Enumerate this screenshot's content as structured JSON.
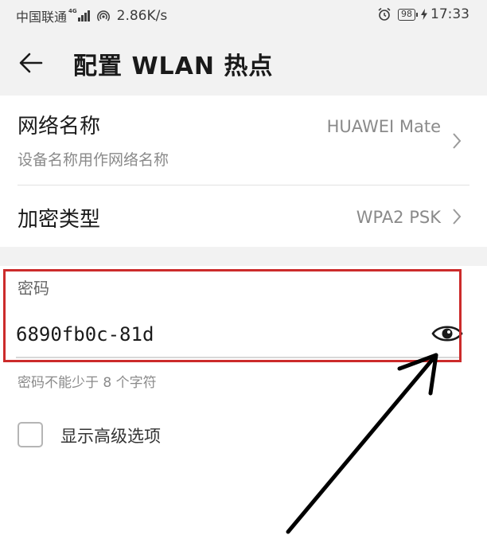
{
  "status_bar": {
    "carrier": "中国联通",
    "network": "4G",
    "speed": "2.86K/s",
    "battery": "98",
    "time": "17:33"
  },
  "header": {
    "title": "配置 WLAN 热点",
    "back_icon": "arrow-left-icon"
  },
  "network_name": {
    "title": "网络名称",
    "subtitle": "设备名称用作网络名称",
    "value": "HUAWEI Mate"
  },
  "encryption": {
    "title": "加密类型",
    "value": "WPA2 PSK"
  },
  "password": {
    "label": "密码",
    "value": "6890fb0c-81d",
    "hint": "密码不能少于 8 个字符",
    "toggle_icon": "eye-icon"
  },
  "advanced": {
    "label": "显示高级选项",
    "checked": false
  },
  "colors": {
    "highlight": "#cc2b2b",
    "background_gray": "#f2f2f2",
    "secondary_text": "#8a8a8a"
  }
}
